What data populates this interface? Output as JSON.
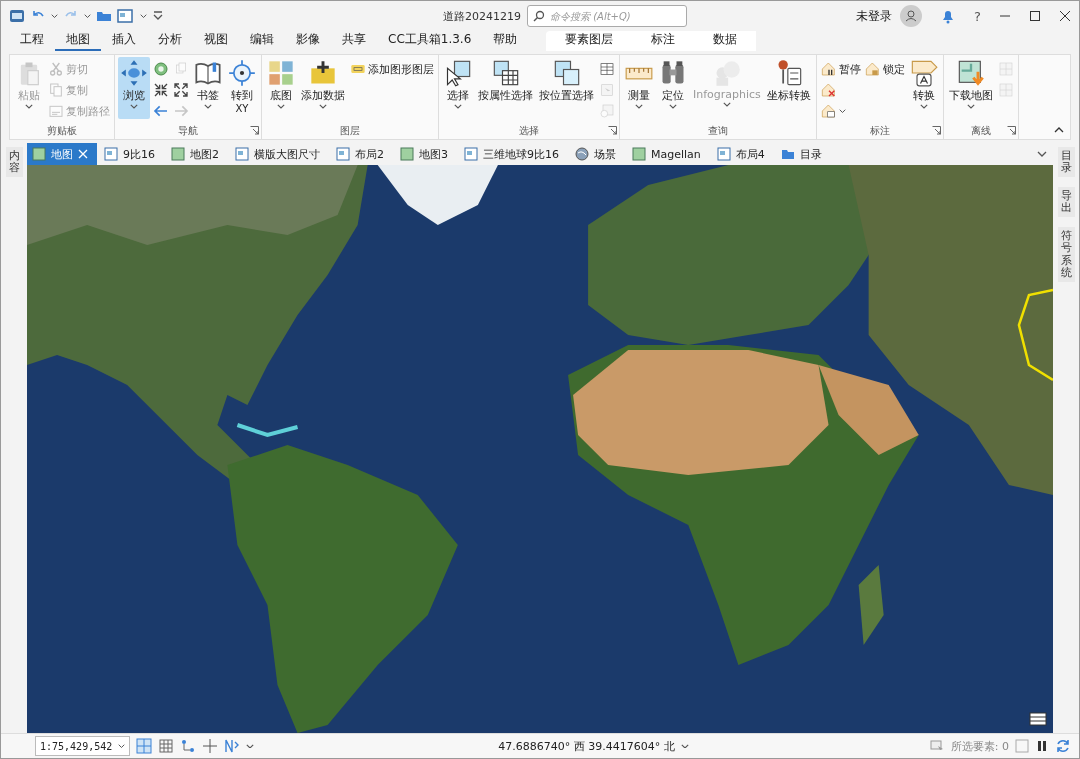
{
  "title_bar": {
    "title": "道路20241219",
    "search_placeholder": "命令搜索 (Alt+Q)",
    "user": "未登录",
    "help": "?"
  },
  "ribbon_tabs": [
    {
      "label": "工程",
      "selected": false,
      "kind": "main"
    },
    {
      "label": "地图",
      "selected": true,
      "kind": "main"
    },
    {
      "label": "插入",
      "selected": false,
      "kind": "main"
    },
    {
      "label": "分析",
      "selected": false,
      "kind": "main"
    },
    {
      "label": "视图",
      "selected": false,
      "kind": "main"
    },
    {
      "label": "编辑",
      "selected": false,
      "kind": "main"
    },
    {
      "label": "影像",
      "selected": false,
      "kind": "main"
    },
    {
      "label": "共享",
      "selected": false,
      "kind": "main"
    },
    {
      "label": "CC工具箱1.3.6",
      "selected": false,
      "kind": "main"
    },
    {
      "label": "帮助",
      "selected": false,
      "kind": "main"
    },
    {
      "label": "要素图层",
      "selected": false,
      "kind": "contextual"
    },
    {
      "label": "标注",
      "selected": false,
      "kind": "contextual"
    },
    {
      "label": "数据",
      "selected": false,
      "kind": "contextual"
    }
  ],
  "ribbon_groups": [
    {
      "title": "剪贴板",
      "launcher": false,
      "items": [
        {
          "kind": "large",
          "label": "粘贴",
          "disabled": true,
          "selected": false,
          "dropdown": true
        },
        {
          "kind": "small",
          "label": "剪切",
          "disabled": true
        },
        {
          "kind": "small",
          "label": "复制",
          "disabled": true
        },
        {
          "kind": "small",
          "label": "复制路径",
          "disabled": true
        }
      ]
    },
    {
      "title": "导航",
      "launcher": true,
      "items": [
        {
          "kind": "large",
          "label": "浏览",
          "disabled": false,
          "selected": true,
          "dropdown": true
        },
        {
          "kind": "small",
          "disabled": false
        },
        {
          "kind": "small",
          "disabled": false
        },
        {
          "kind": "small",
          "disabled": false
        },
        {
          "kind": "small",
          "disabled": true
        },
        {
          "kind": "small",
          "disabled": false
        },
        {
          "kind": "small",
          "disabled": true
        },
        {
          "kind": "large",
          "label": "书签",
          "disabled": false,
          "selected": false,
          "dropdown": true
        },
        {
          "kind": "large",
          "label": "转到",
          "sublabel": "XY",
          "disabled": false,
          "selected": false,
          "dropdown": false
        }
      ]
    },
    {
      "title": "图层",
      "launcher": false,
      "items": [
        {
          "kind": "large",
          "label": "底图",
          "disabled": false,
          "selected": false,
          "dropdown": true
        },
        {
          "kind": "large",
          "label": "添加数据",
          "disabled": false,
          "selected": false,
          "dropdown": true
        },
        {
          "kind": "small",
          "label": "添加图形图层",
          "disabled": false
        }
      ]
    },
    {
      "title": "选择",
      "launcher": true,
      "items": [
        {
          "kind": "large",
          "label": "选择",
          "disabled": false,
          "selected": false,
          "dropdown": true
        },
        {
          "kind": "large",
          "label": "按属性选择",
          "disabled": false,
          "selected": false,
          "dropdown": false
        },
        {
          "kind": "large",
          "label": "按位置选择",
          "disabled": false,
          "selected": false,
          "dropdown": false
        },
        {
          "kind": "small",
          "disabled": false
        },
        {
          "kind": "small",
          "disabled": true
        },
        {
          "kind": "small",
          "disabled": true
        }
      ]
    },
    {
      "title": "查询",
      "launcher": false,
      "items": [
        {
          "kind": "large",
          "label": "测量",
          "disabled": false,
          "selected": false,
          "dropdown": true
        },
        {
          "kind": "large",
          "label": "定位",
          "disabled": false,
          "selected": false,
          "dropdown": true
        },
        {
          "kind": "large",
          "label": "Infographics",
          "disabled": true,
          "selected": false,
          "dropdown": true
        },
        {
          "kind": "large",
          "label": "坐标转换",
          "disabled": false,
          "selected": false,
          "dropdown": false
        }
      ]
    },
    {
      "title": "标注",
      "launcher": true,
      "items": [
        {
          "kind": "small",
          "label": "暂停",
          "disabled": false
        },
        {
          "kind": "small",
          "disabled": false
        },
        {
          "kind": "small",
          "disabled": false,
          "dropdown": true
        },
        {
          "kind": "small",
          "label": "锁定",
          "disabled": false
        },
        {
          "kind": "large",
          "label": "转换",
          "disabled": false,
          "selected": false,
          "dropdown": true
        }
      ]
    },
    {
      "title": "离线",
      "launcher": true,
      "items": [
        {
          "kind": "large",
          "label": "下载地图",
          "disabled": false,
          "selected": false,
          "dropdown": true
        },
        {
          "kind": "small",
          "disabled": true
        },
        {
          "kind": "small",
          "disabled": true
        }
      ]
    }
  ],
  "left_panels": [
    "内容"
  ],
  "doc_tabs": [
    {
      "label": "地图",
      "selected": true,
      "kind": "map"
    },
    {
      "label": "9比16",
      "selected": false,
      "kind": "layout"
    },
    {
      "label": "地图2",
      "selected": false,
      "kind": "map"
    },
    {
      "label": "横版大图尺寸",
      "selected": false,
      "kind": "layout"
    },
    {
      "label": "布局2",
      "selected": false,
      "kind": "layout"
    },
    {
      "label": "地图3",
      "selected": false,
      "kind": "map"
    },
    {
      "label": "三维地球9比16",
      "selected": false,
      "kind": "layout"
    },
    {
      "label": "场景",
      "selected": false,
      "kind": "scene"
    },
    {
      "label": "Magellan",
      "selected": false,
      "kind": "map"
    },
    {
      "label": "布局4",
      "selected": false,
      "kind": "layout"
    },
    {
      "label": "目录",
      "selected": false,
      "kind": "catalog"
    }
  ],
  "right_panels": [
    "目录",
    "导出",
    "符号系统"
  ],
  "status_bar": {
    "scale": "1:75,429,542",
    "coordinates": "47.6886740° 西 39.4417604° 北",
    "selected_features": "所选要素: 0"
  }
}
